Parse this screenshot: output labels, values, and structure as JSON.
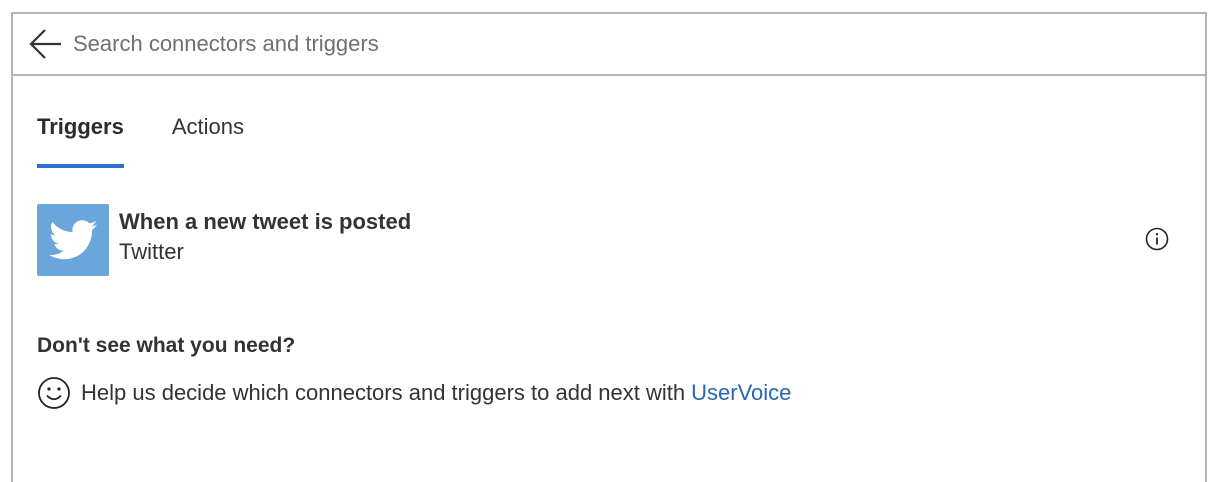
{
  "search": {
    "placeholder": "Search connectors and triggers"
  },
  "tabs": [
    {
      "label": "Triggers",
      "active": true
    },
    {
      "label": "Actions",
      "active": false
    }
  ],
  "triggers": [
    {
      "title": "When a new tweet is posted",
      "connector": "Twitter",
      "icon": "twitter-bird-icon",
      "tile_color": "#6aa6db"
    }
  ],
  "help": {
    "title": "Don't see what you need?",
    "text": "Help us decide which connectors and triggers to add next with",
    "link_label": "UserVoice",
    "icon": "smiley-icon"
  },
  "colors": {
    "accent": "#2f6fce",
    "link": "#2a66b4",
    "border": "#b3b3b3"
  }
}
